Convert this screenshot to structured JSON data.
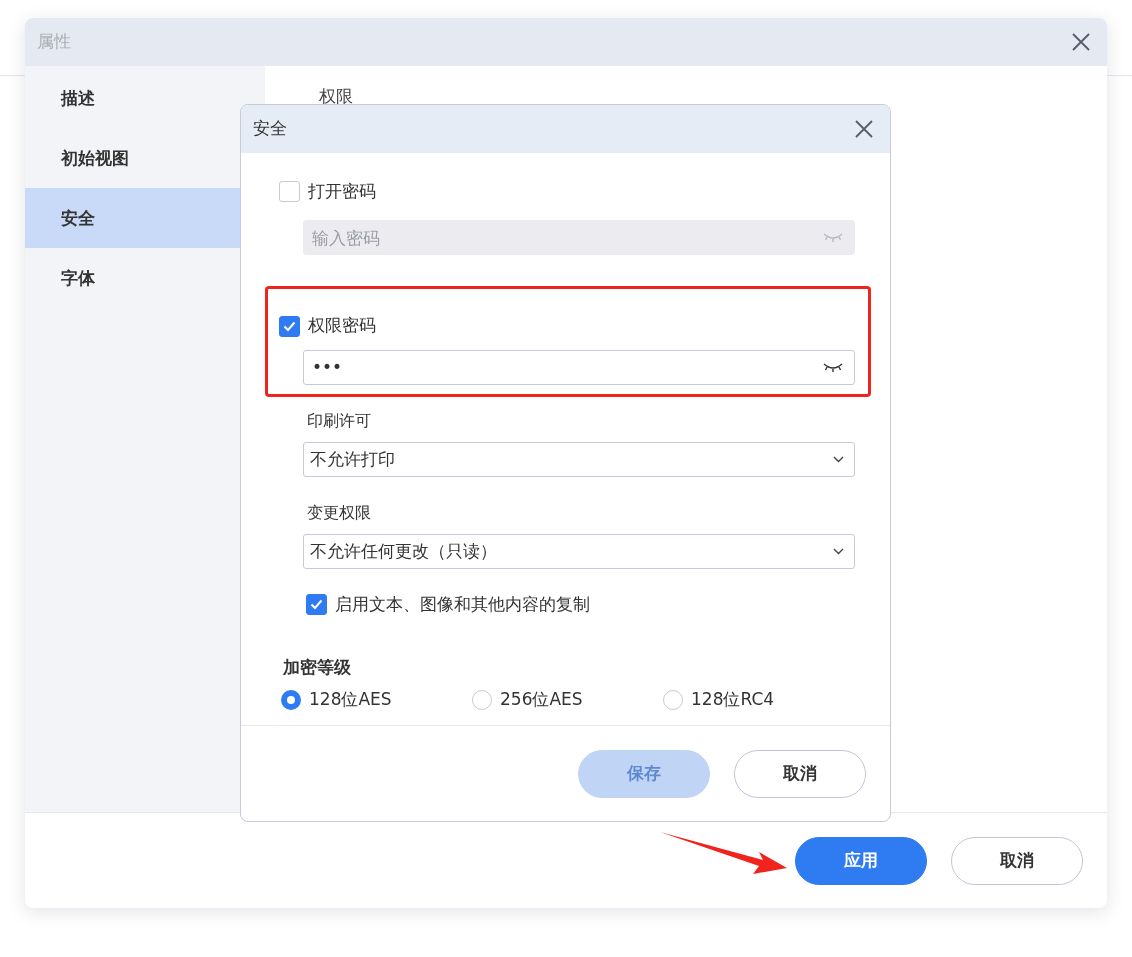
{
  "window": {
    "title": "属性"
  },
  "sidebar": {
    "items": [
      {
        "label": "描述",
        "selected": false
      },
      {
        "label": "初始视图",
        "selected": false
      },
      {
        "label": "安全",
        "selected": true
      },
      {
        "label": "字体",
        "selected": false
      }
    ]
  },
  "content": {
    "heading": "权限"
  },
  "dialog": {
    "title": "安全",
    "open_password": {
      "label": "打开密码",
      "checked": false,
      "placeholder": "输入密码"
    },
    "permission_password": {
      "label": "权限密码",
      "checked": true,
      "value": "•••"
    },
    "print_permission": {
      "label": "印刷许可",
      "value": "不允许打印"
    },
    "change_permission": {
      "label": "变更权限",
      "value": "不允许任何更改（只读）"
    },
    "copy": {
      "label": "启用文本、图像和其他内容的复制",
      "checked": true
    },
    "encryption": {
      "label": "加密等级",
      "options": [
        {
          "label": "128位AES",
          "selected": true
        },
        {
          "label": "256位AES",
          "selected": false
        },
        {
          "label": "128位RC4",
          "selected": false
        }
      ]
    },
    "buttons": [
      {
        "label": "保存",
        "kind": "primary",
        "disabled": true
      },
      {
        "label": "取消",
        "kind": "secondary",
        "disabled": false
      }
    ]
  },
  "buttons": [
    {
      "label": "应用",
      "kind": "primary"
    },
    {
      "label": "取消",
      "kind": "secondary"
    }
  ]
}
